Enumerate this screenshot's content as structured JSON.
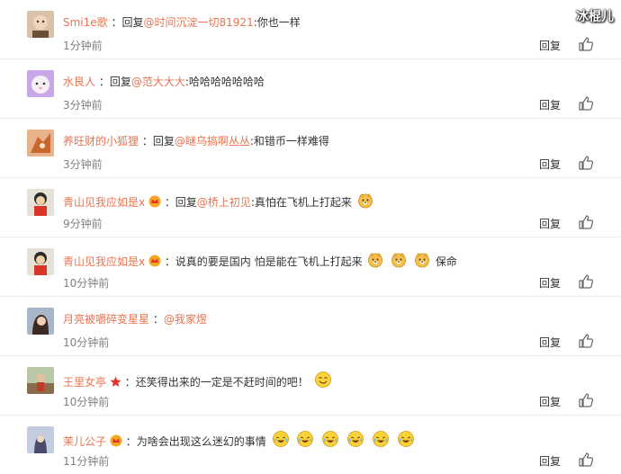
{
  "watermark": "冰棍儿",
  "reply_label": "回复",
  "comments": [
    {
      "user": "Smi1e歌",
      "sep": "：",
      "prefix": "回复",
      "mention": "@时间沉淀一切81921",
      "text": ":你也一样",
      "time": "1分钟前"
    },
    {
      "user": "水艮人",
      "sep": "：",
      "prefix": "回复",
      "mention": "@范大大大",
      "text": ":哈哈哈哈哈哈哈",
      "time": "3分钟前"
    },
    {
      "user": "养旺财的小狐狸",
      "sep": "：",
      "prefix": "回复",
      "mention": "@瞇乌搞啊丛丛",
      "text": ":和错币一样难得",
      "time": "3分钟前"
    },
    {
      "user": "青山见我应如是x",
      "sep": "：",
      "prefix": "回复",
      "mention": "@桥上初见",
      "text": ":真怕在飞机上打起来",
      "time": "9分钟前"
    },
    {
      "user": "青山见我应如是x",
      "sep": "：",
      "text": "说真的要是国内 怕是能在飞机上打起来",
      "text2": "保命",
      "time": "10分钟前"
    },
    {
      "user": "月亮被嚼碎变星星",
      "sep": "：",
      "mention": "@我家煜",
      "time": "10分钟前"
    },
    {
      "user": "王里女亭",
      "sep": "：",
      "text": "还笑得出来的一定是不赶时间的吧！",
      "time": "10分钟前"
    },
    {
      "user": "茉儿公子",
      "sep": "：",
      "text": "为啥会出现这么迷幻的事情",
      "time": "11分钟前"
    }
  ],
  "colors": {
    "username": "#eb7350",
    "time": "#808080",
    "divider": "#eeeeee",
    "badge_gold": "#f5a623",
    "badge_star": "#e8322c"
  },
  "icons": {
    "like": "thumbs-up-icon",
    "vip": "vip-crown-badge-icon",
    "star": "star-badge-icon",
    "emoji_doge": "doge-emoji-icon",
    "emoji_smile": "smile-emoji-icon",
    "emoji_cry": "laugh-cry-emoji-icon"
  }
}
